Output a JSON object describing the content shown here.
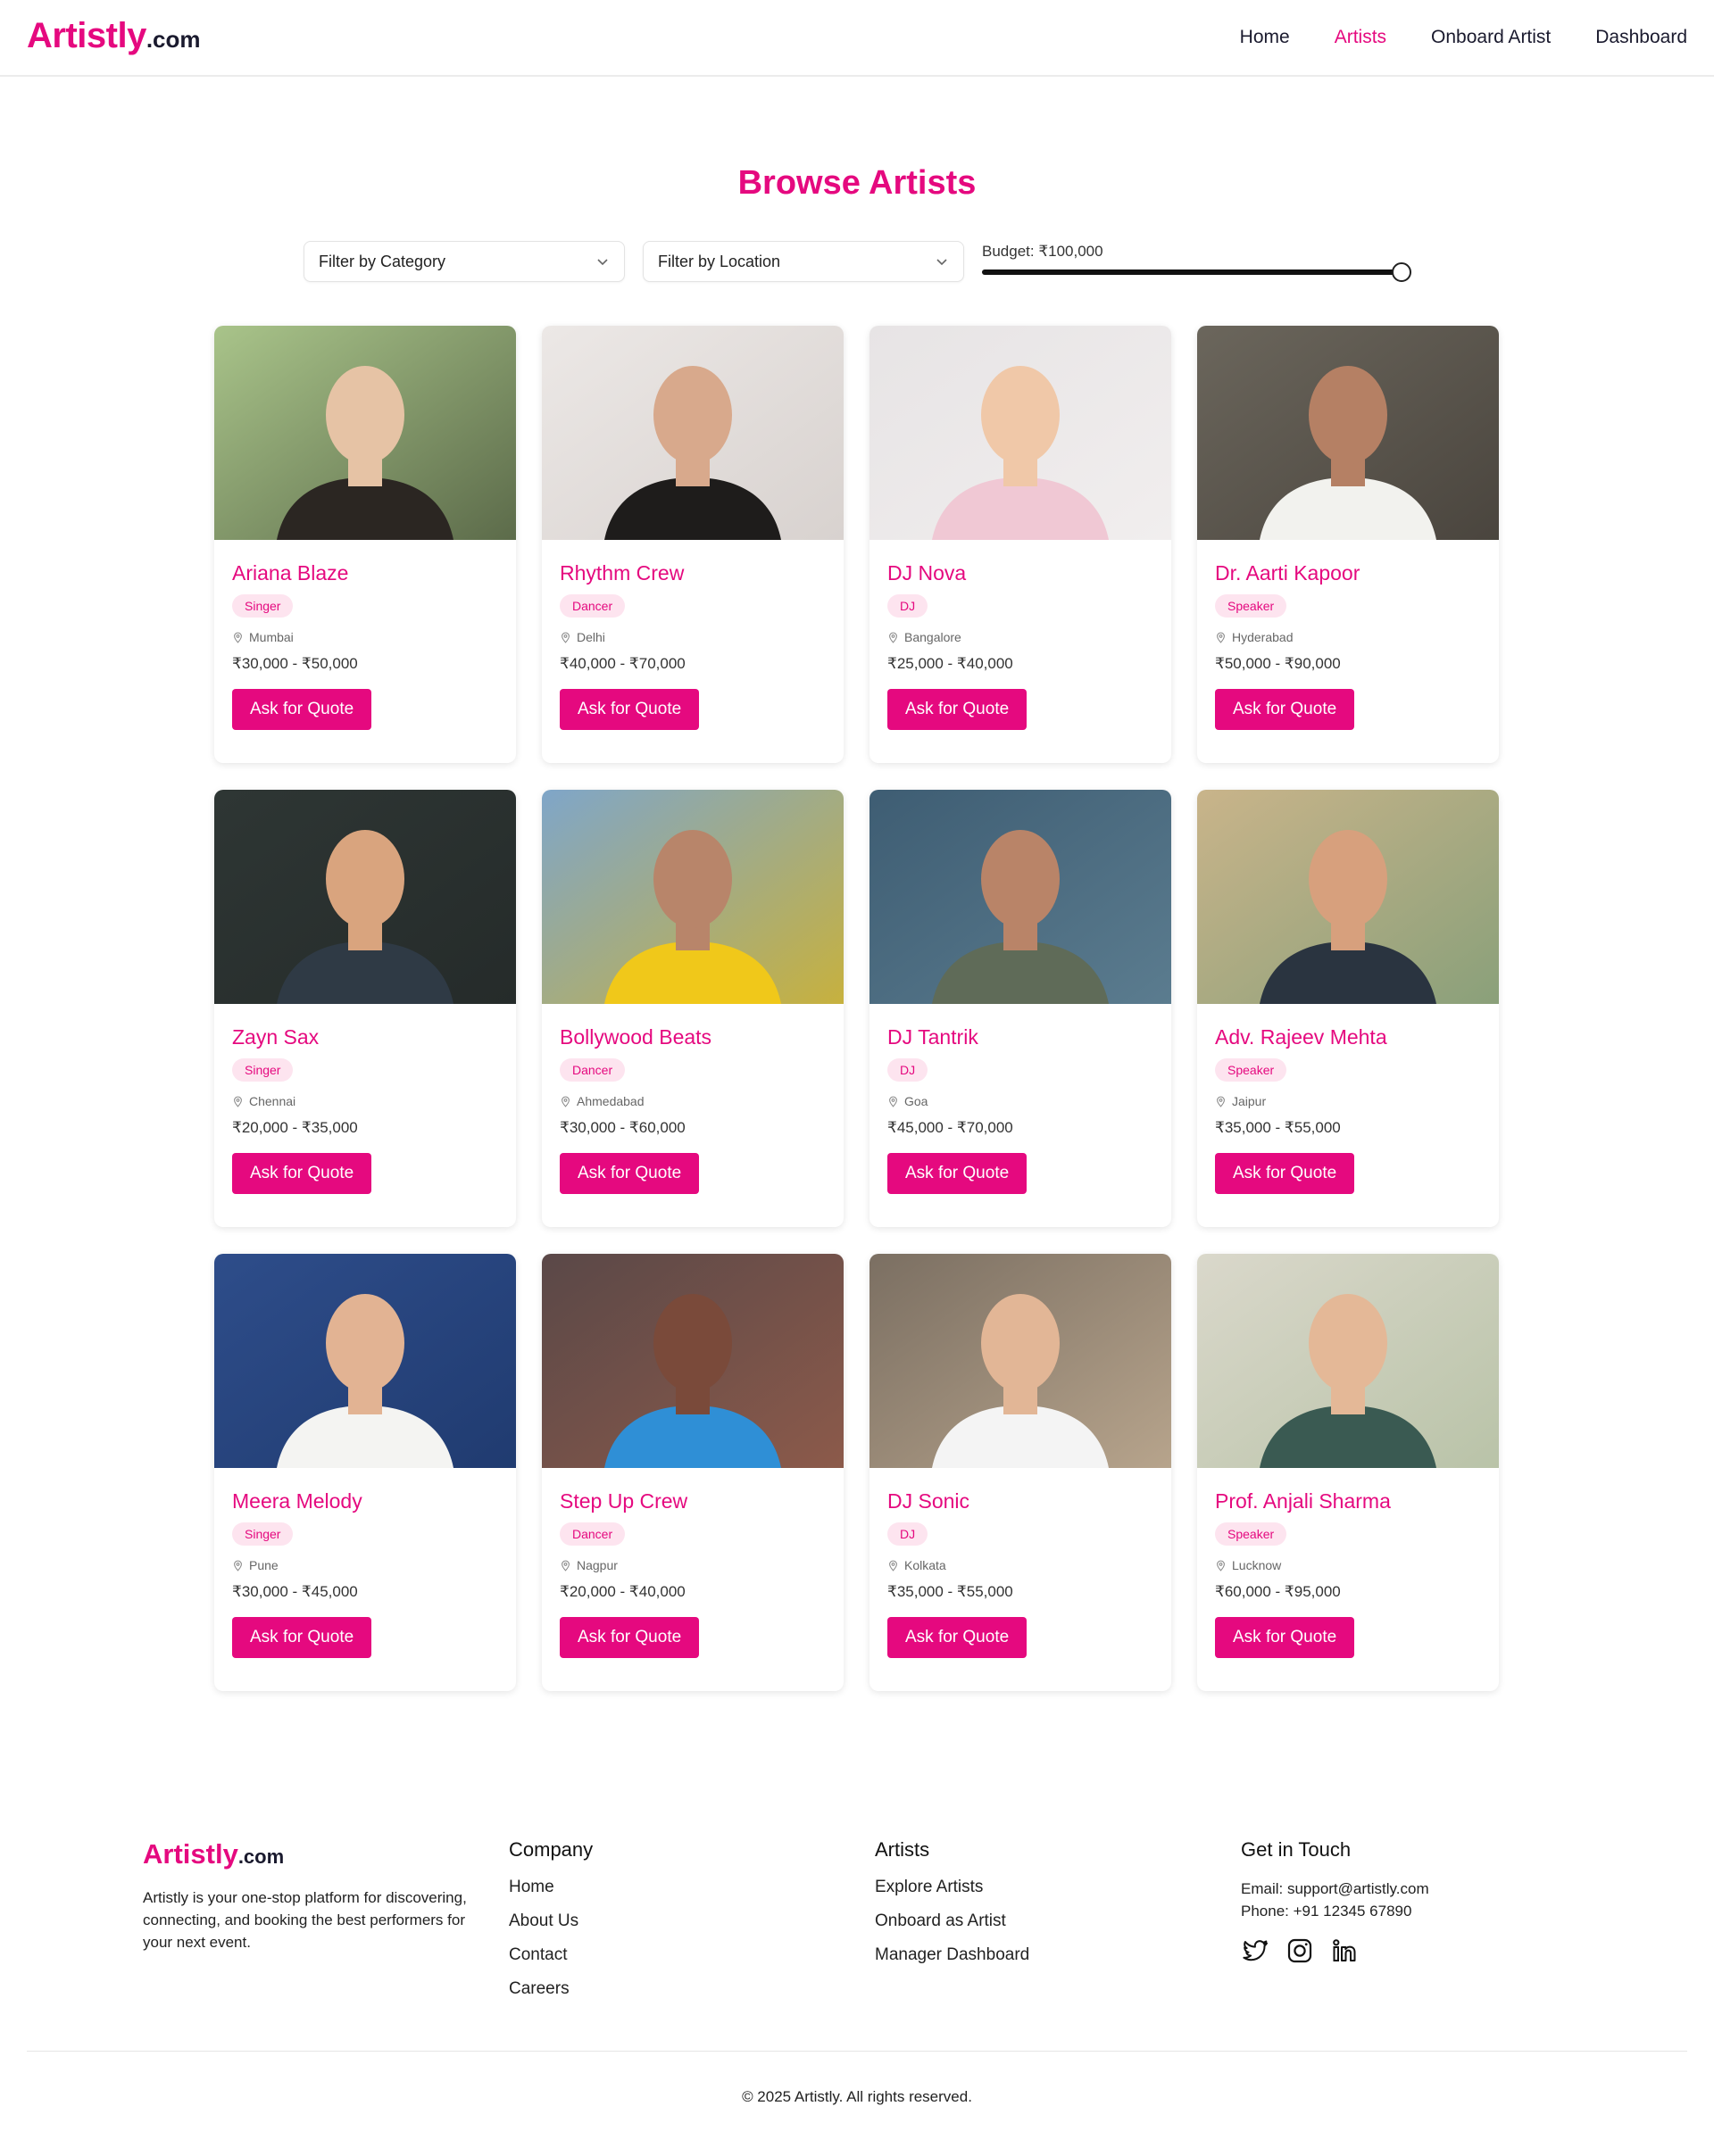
{
  "header": {
    "logo_brand": "Artistly",
    "logo_tld": ".com",
    "nav": [
      {
        "label": "Home"
      },
      {
        "label": "Artists",
        "active": true
      },
      {
        "label": "Onboard Artist"
      },
      {
        "label": "Dashboard"
      }
    ]
  },
  "page_title": "Browse Artists",
  "filters": {
    "category": "Filter by Category",
    "location": "Filter by Location",
    "budget_label": "Budget: ₹100,000",
    "budget_level": 1.0
  },
  "colors": {
    "accent": "#e5097f",
    "tag_bg": "#fde4ef",
    "dark": "#1a1a2e"
  },
  "artists": [
    {
      "name": "Ariana Blaze",
      "category": "Singer",
      "location": "Mumbai",
      "price": "₹30,000 - ₹50,000",
      "cta": "Ask for Quote"
    },
    {
      "name": "Rhythm Crew",
      "category": "Dancer",
      "location": "Delhi",
      "price": "₹40,000 - ₹70,000",
      "cta": "Ask for Quote"
    },
    {
      "name": "DJ Nova",
      "category": "DJ",
      "location": "Bangalore",
      "price": "₹25,000 - ₹40,000",
      "cta": "Ask for Quote"
    },
    {
      "name": "Dr. Aarti Kapoor",
      "category": "Speaker",
      "location": "Hyderabad",
      "price": "₹50,000 - ₹90,000",
      "cta": "Ask for Quote"
    },
    {
      "name": "Zayn Sax",
      "category": "Singer",
      "location": "Chennai",
      "price": "₹20,000 - ₹35,000",
      "cta": "Ask for Quote"
    },
    {
      "name": "Bollywood Beats",
      "category": "Dancer",
      "location": "Ahmedabad",
      "price": "₹30,000 - ₹60,000",
      "cta": "Ask for Quote"
    },
    {
      "name": "DJ Tantrik",
      "category": "DJ",
      "location": "Goa",
      "price": "₹45,000 - ₹70,000",
      "cta": "Ask for Quote"
    },
    {
      "name": "Adv. Rajeev Mehta",
      "category": "Speaker",
      "location": "Jaipur",
      "price": "₹35,000 - ₹55,000",
      "cta": "Ask for Quote"
    },
    {
      "name": "Meera Melody",
      "category": "Singer",
      "location": "Pune",
      "price": "₹30,000 - ₹45,000",
      "cta": "Ask for Quote"
    },
    {
      "name": "Step Up Crew",
      "category": "Dancer",
      "location": "Nagpur",
      "price": "₹20,000 - ₹40,000",
      "cta": "Ask for Quote"
    },
    {
      "name": "DJ Sonic",
      "category": "DJ",
      "location": "Kolkata",
      "price": "₹35,000 - ₹55,000",
      "cta": "Ask for Quote"
    },
    {
      "name": "Prof. Anjali Sharma",
      "category": "Speaker",
      "location": "Lucknow",
      "price": "₹60,000 - ₹95,000",
      "cta": "Ask for Quote"
    }
  ],
  "footer": {
    "brand": "Artistly",
    "tld": ".com",
    "description": "Artistly is your one-stop platform for discovering, connecting, and booking the best performers for your next event.",
    "company_title": "Company",
    "company_links": [
      "Home",
      "About Us",
      "Contact",
      "Careers"
    ],
    "artists_title": "Artists",
    "artists_links": [
      "Explore Artists",
      "Onboard as Artist",
      "Manager Dashboard"
    ],
    "contact_title": "Get in Touch",
    "email": "Email: support@artistly.com",
    "phone": "Phone: +91 12345 67890",
    "social_icons": [
      "twitter-icon",
      "instagram-icon",
      "linkedin-icon"
    ],
    "copyright": "© 2025 Artistly. All rights reserved."
  }
}
